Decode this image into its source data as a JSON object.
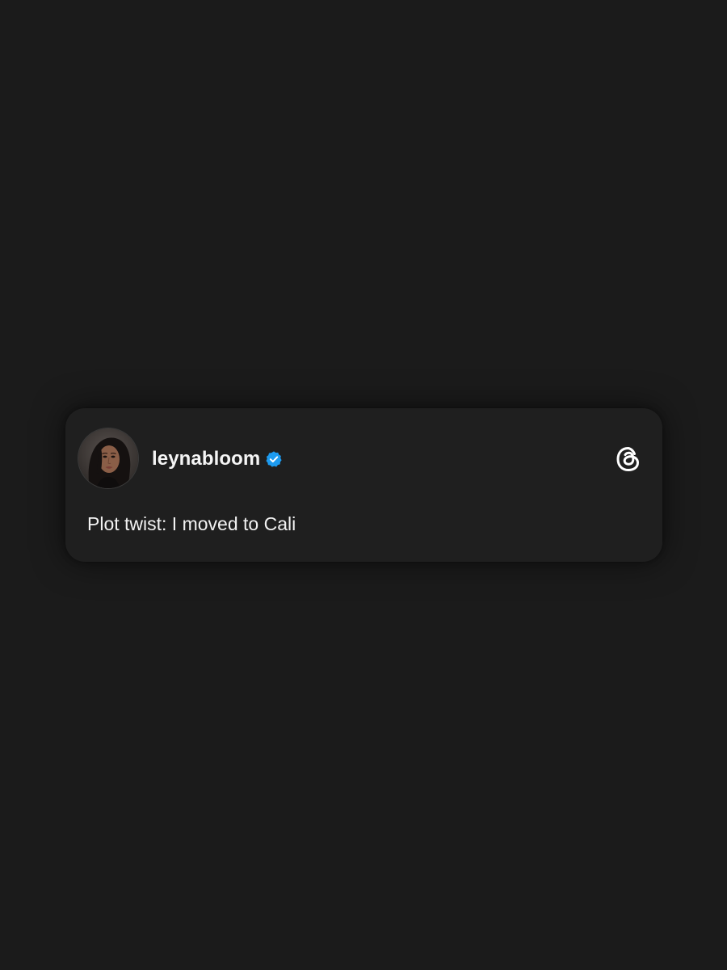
{
  "post": {
    "username": "leynabloom",
    "verified": true,
    "text": "Plot twist: I moved to Cali"
  },
  "icons": {
    "avatar": "profile-photo",
    "verified": "verified-badge-icon",
    "brand": "threads-logo-icon"
  },
  "colors": {
    "background": "#1b1b1b",
    "card": "#1f1f1f",
    "text": "#f5f5f5",
    "verified": "#1d9bf0"
  }
}
